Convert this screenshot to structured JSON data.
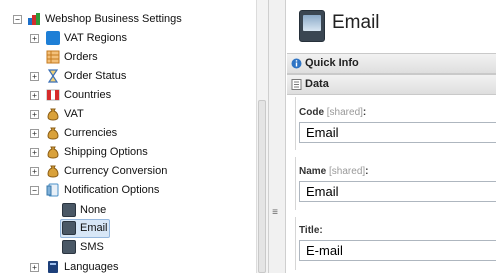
{
  "tree": {
    "root": {
      "label": "Webshop Business Settings",
      "toggle": "−"
    },
    "items": [
      {
        "label": "VAT Regions",
        "toggle": "+",
        "icon": "vat-regions-icon",
        "color": "#1e7fd6"
      },
      {
        "label": "Orders",
        "toggle": "",
        "icon": "orders-icon",
        "color": "#e0862b"
      },
      {
        "label": "Order Status",
        "toggle": "+",
        "icon": "hourglass-icon",
        "color": "#3b6fb6"
      },
      {
        "label": "Countries",
        "toggle": "+",
        "icon": "flag-icon",
        "color": "#d62b2b"
      },
      {
        "label": "VAT",
        "toggle": "+",
        "icon": "money-bag-icon",
        "color": "#c58a22"
      },
      {
        "label": "Currencies",
        "toggle": "+",
        "icon": "money-bag-icon",
        "color": "#c58a22"
      },
      {
        "label": "Shipping Options",
        "toggle": "+",
        "icon": "money-bag-icon",
        "color": "#c58a22"
      },
      {
        "label": "Currency Conversion",
        "toggle": "+",
        "icon": "money-bag-icon",
        "color": "#c58a22"
      },
      {
        "label": "Notification Options",
        "toggle": "−",
        "icon": "notification-icon",
        "color": "#4a90c8"
      }
    ],
    "children": [
      {
        "label": "None",
        "icon": "device-icon"
      },
      {
        "label": "Email",
        "icon": "device-icon",
        "selected": true
      },
      {
        "label": "SMS",
        "icon": "device-icon"
      }
    ],
    "after": [
      {
        "label": "Languages",
        "toggle": "+",
        "icon": "languages-icon",
        "color": "#1c3f7a"
      }
    ]
  },
  "editor": {
    "title": "Email",
    "sections": {
      "quick_info": "Quick Info",
      "data": "Data"
    },
    "fields": [
      {
        "label": "Code",
        "tag": "[shared]",
        "colon": ":",
        "value": "Email"
      },
      {
        "label": "Name",
        "tag": "[shared]",
        "colon": ":",
        "value": "Email"
      },
      {
        "label": "Title",
        "tag": "",
        "colon": ":",
        "value": "E-mail"
      }
    ]
  },
  "colors": {
    "selection": "#d8e7f7",
    "section_bar": "#e6e6e6"
  }
}
